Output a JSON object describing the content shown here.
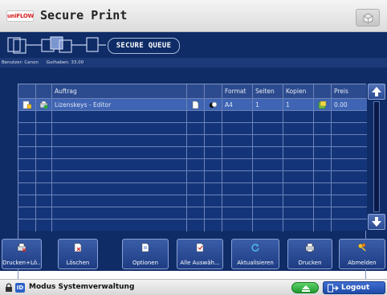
{
  "app": {
    "logo": "uniFLOW",
    "title": "Secure Print"
  },
  "queue": {
    "label": "SECURE QUEUE"
  },
  "user_info": {
    "user": "Benutzer: Canon",
    "balance": "Guthaben: 33.00"
  },
  "table": {
    "headers": [
      "",
      "",
      "Auftrag",
      "",
      "",
      "Format",
      "Seiten",
      "Kopien",
      "",
      "Preis"
    ],
    "rows": [
      {
        "name": "Lizenskeys - Editor",
        "format": "A4",
        "pages": "1",
        "copies": "1",
        "price": "0.00",
        "selected": true
      }
    ],
    "empty_rows": 10
  },
  "actions": [
    {
      "label": "Drucken+Lö...",
      "icon": "print-delete-icon"
    },
    {
      "label": "Löschen",
      "icon": "delete-icon"
    },
    {
      "label": "Optionen",
      "icon": "options-icon"
    },
    {
      "label": "Alle Auswäh...",
      "icon": "select-all-icon"
    },
    {
      "label": "Aktualisieren",
      "icon": "refresh-icon"
    },
    {
      "label": "Drucken",
      "icon": "print-icon"
    },
    {
      "label": "Abmelden",
      "icon": "logout-keys-icon"
    }
  ],
  "status": {
    "mode": "Modus Systemverwaltung",
    "logout": "Logout"
  },
  "colors": {
    "panel": "#0f2c67",
    "selected_row": "#3e64b3",
    "eject": "#2fb33f",
    "logout": "#1f4aa8"
  }
}
